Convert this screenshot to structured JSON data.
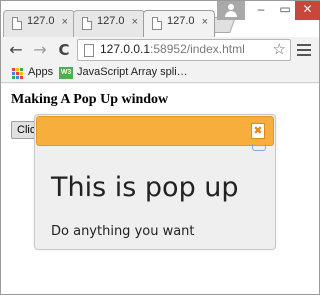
{
  "tabs": [
    {
      "title": "127.0",
      "close": "×"
    },
    {
      "title": "127.0",
      "close": "×"
    },
    {
      "title": "127.0",
      "close": "×",
      "active": true
    }
  ],
  "window_controls": {
    "minimize": "–",
    "maximize": "▭",
    "close": "✕"
  },
  "toolbar": {
    "back": "←",
    "forward": "→",
    "reload": "C",
    "url_host": "127.0.0.1",
    "url_rest": ":58952/index.html",
    "star": "☆"
  },
  "bookmarks": {
    "apps_label": "Apps",
    "items": [
      {
        "label": "JavaScript Array spli…",
        "icon": "w3schools-icon"
      }
    ],
    "apps_colors": [
      "#e94235",
      "#fbbc05",
      "#34a853",
      "#4285f4",
      "#e94235",
      "#fbbc05",
      "#34a853",
      "#4285f4",
      "#e94235"
    ]
  },
  "page": {
    "heading": "Making A Pop Up window",
    "open_button": "Click",
    "popup": {
      "close": "✖",
      "title": "This is pop up",
      "text": "Do anything you want"
    }
  },
  "colors": {
    "popup_header": "#f8ae3c",
    "close_button": "#c8463a"
  }
}
